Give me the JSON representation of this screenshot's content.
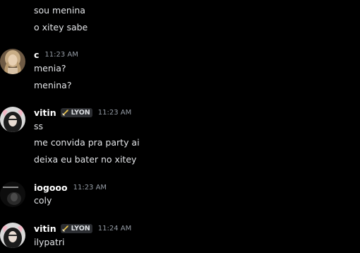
{
  "messages": {
    "m0": {
      "lines": [
        "sou menina",
        "o xitey sabe"
      ]
    },
    "m1": {
      "username": "c",
      "timestamp": "11:23 AM",
      "lines": [
        "menia?",
        "menina?"
      ]
    },
    "m2": {
      "username": "vitin",
      "tag": "LYON",
      "tag_icon": "sword-icon",
      "timestamp": "11:23 AM",
      "lines": [
        "ss",
        "me convida pra party ai",
        "deixa eu bater no xitey"
      ]
    },
    "m3": {
      "username": "iogooo",
      "timestamp": "11:23 AM",
      "lines": [
        "coly"
      ]
    },
    "m4": {
      "username": "vitin",
      "tag": "LYON",
      "tag_icon": "sword-icon",
      "timestamp": "11:24 AM",
      "lines": [
        "ilypatri"
      ]
    }
  },
  "colors": {
    "background": "#000000",
    "username": "#ffffff",
    "timestamp": "#949ba4",
    "message_text": "#e3e5e8",
    "tag_background": "#2b2d31"
  }
}
